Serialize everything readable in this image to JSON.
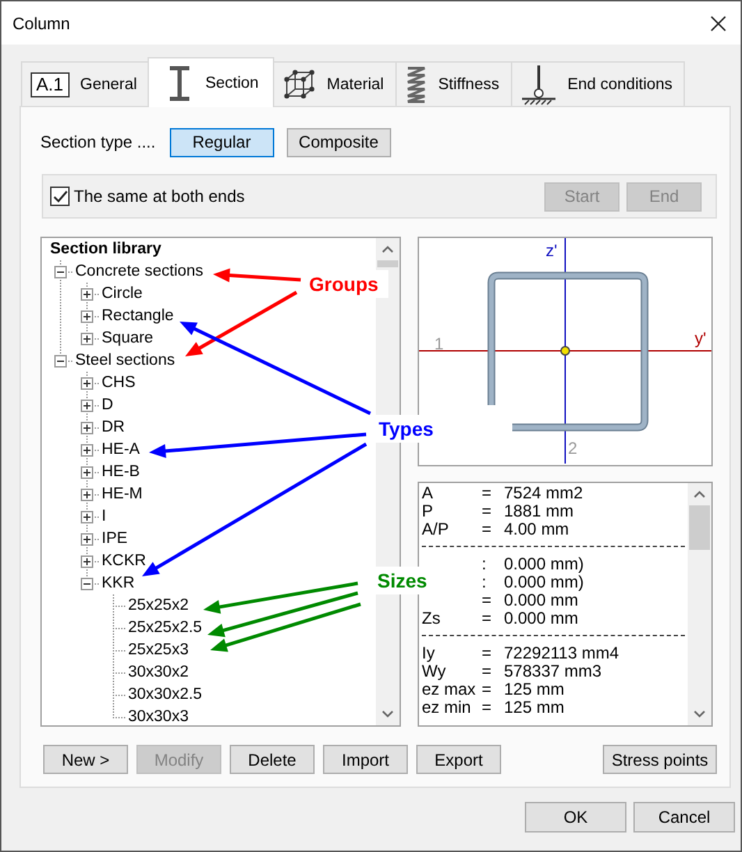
{
  "window": {
    "title": "Column"
  },
  "tabs": [
    {
      "label": "General",
      "badge": "A.1",
      "selected": false
    },
    {
      "label": "Section",
      "selected": true
    },
    {
      "label": "Material",
      "selected": false
    },
    {
      "label": "Stiffness",
      "selected": false
    },
    {
      "label": "End conditions",
      "selected": false
    }
  ],
  "section_type": {
    "label": "Section type ....",
    "options": [
      {
        "label": "Regular",
        "selected": true
      },
      {
        "label": "Composite",
        "selected": false
      }
    ]
  },
  "ends": {
    "label": "The same at both ends",
    "checked": true,
    "buttons": [
      {
        "label": "Start",
        "disabled": true
      },
      {
        "label": "End",
        "disabled": true
      }
    ]
  },
  "section_library": {
    "title": "Section library",
    "groups": [
      {
        "label": "Concrete sections",
        "expanded": true,
        "children": [
          {
            "label": "Circle",
            "expanded": false
          },
          {
            "label": "Rectangle",
            "expanded": false
          },
          {
            "label": "Square",
            "expanded": false
          }
        ]
      },
      {
        "label": "Steel sections",
        "expanded": true,
        "children": [
          {
            "label": "CHS",
            "expanded": false
          },
          {
            "label": "D",
            "expanded": false
          },
          {
            "label": "DR",
            "expanded": false
          },
          {
            "label": "HE-A",
            "expanded": false
          },
          {
            "label": "HE-B",
            "expanded": false
          },
          {
            "label": "HE-M",
            "expanded": false
          },
          {
            "label": "I",
            "expanded": false
          },
          {
            "label": "IPE",
            "expanded": false
          },
          {
            "label": "KCKR",
            "expanded": false
          },
          {
            "label": "KKR",
            "expanded": true,
            "children": [
              {
                "label": "25x25x2"
              },
              {
                "label": "25x25x2.5"
              },
              {
                "label": "25x25x3"
              },
              {
                "label": "30x30x2"
              },
              {
                "label": "30x30x2.5"
              },
              {
                "label": "30x30x3"
              }
            ]
          }
        ]
      }
    ]
  },
  "section_drawing": {
    "z_label": "z'",
    "y_label": "y'",
    "point_1": "1",
    "point_2": "2"
  },
  "properties": [
    {
      "kind": "row",
      "label": "A",
      "sign": "=",
      "value": "7524 mm2"
    },
    {
      "kind": "row",
      "label": "P",
      "sign": "=",
      "value": "1881 mm"
    },
    {
      "kind": "row",
      "label": "A/P",
      "sign": "=",
      "value": "4.00 mm"
    },
    {
      "kind": "separator"
    },
    {
      "kind": "row",
      "sign": ":",
      "value": "0.000 mm)"
    },
    {
      "kind": "row",
      "sign": ":",
      "value": "0.000 mm)"
    },
    {
      "kind": "row",
      "sign": "=",
      "value": "0.000 mm"
    },
    {
      "kind": "row",
      "label": "Zs",
      "sign": "=",
      "value": "0.000 mm"
    },
    {
      "kind": "separator"
    },
    {
      "kind": "row",
      "label": "Iy",
      "sign": "=",
      "value": "72292113 mm4"
    },
    {
      "kind": "row",
      "label": "Wy",
      "sign": "=",
      "value": "578337 mm3"
    },
    {
      "kind": "row",
      "label": "ez max",
      "sign": "=",
      "value": "125 mm"
    },
    {
      "kind": "row",
      "label": "ez min",
      "sign": "=",
      "value": "125 mm"
    }
  ],
  "actions": [
    {
      "label": "New >",
      "disabled": false
    },
    {
      "label": "Modify",
      "disabled": true
    },
    {
      "label": "Delete",
      "disabled": false
    },
    {
      "label": "Import",
      "disabled": false
    },
    {
      "label": "Export",
      "disabled": false
    },
    {
      "label": "Stress points",
      "disabled": false
    }
  ],
  "dialog_buttons": [
    "OK",
    "Cancel"
  ],
  "annotations": [
    {
      "text": "Groups",
      "color": "#ff0000"
    },
    {
      "text": "Types",
      "color": "#0000ff"
    },
    {
      "text": "Sizes",
      "color": "#008a00"
    }
  ]
}
